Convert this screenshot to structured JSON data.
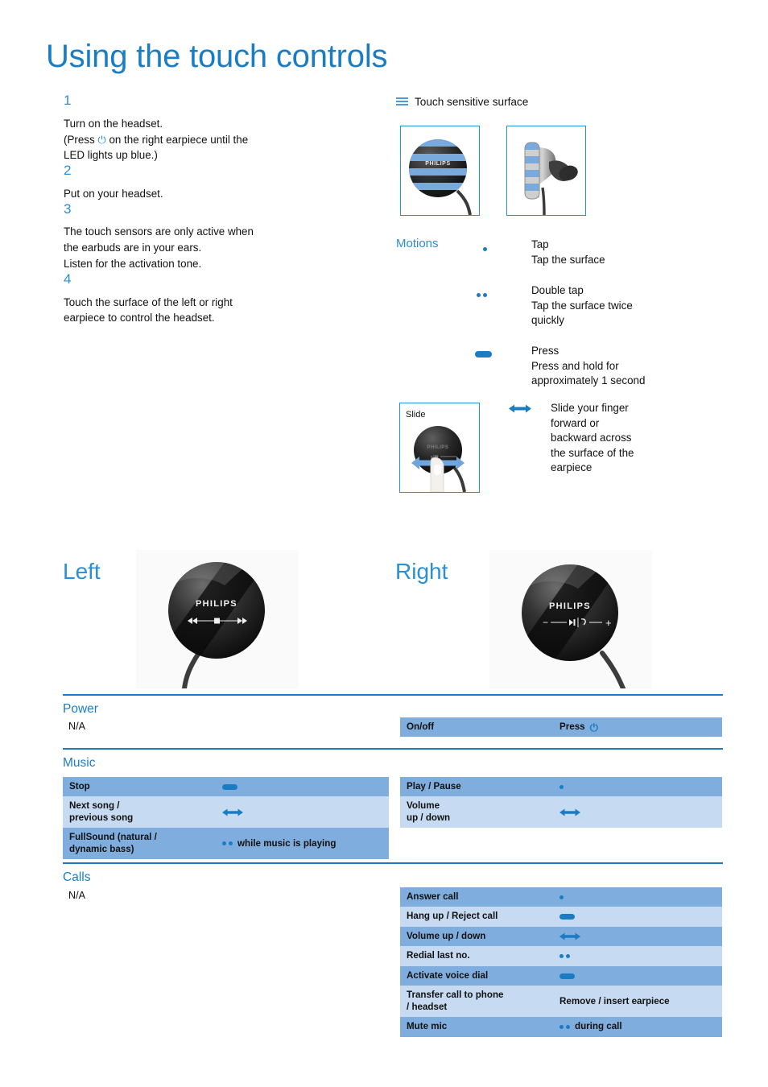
{
  "title": "Using the touch controls",
  "steps": [
    {
      "num": "1",
      "text": "Turn on the headset.\n(Press ⏻ on the right earpiece until the\nLED lights up blue.)"
    },
    {
      "num": "2",
      "text": "Put on your headset."
    },
    {
      "num": "3",
      "text": "The touch sensors are only active when\nthe earbuds are in your ears.\nListen for the activation tone."
    },
    {
      "num": "4",
      "text": "Touch the surface of the left or right\nearpiece to control the headset."
    }
  ],
  "touch_surface": {
    "heading": "Touch sensitive surface",
    "icon": "hamburger-lines-icon",
    "images": [
      {
        "name": "earpiece-front-striped",
        "brand": "PHILIPS"
      },
      {
        "name": "earpiece-side-striped"
      }
    ]
  },
  "motions": {
    "label": "Motions",
    "items": [
      {
        "icon": "single-dot-icon",
        "title": "Tap",
        "desc": "Tap the surface"
      },
      {
        "icon": "double-dot-icon",
        "title": "Double tap",
        "desc": "Tap the surface twice\nquickly"
      },
      {
        "icon": "press-bar-icon",
        "title": "Press",
        "desc": "Press and hold for\napproximately 1 second"
      },
      {
        "icon": "double-arrow-icon",
        "title": "",
        "desc": "Slide your finger\nforward or\nbackward across\nthe surface of the\nearpiece"
      }
    ],
    "slide_box_label": "Slide"
  },
  "earpieces": {
    "left": {
      "title": "Left",
      "brand": "PHILIPS",
      "controls": [
        "rewind",
        "stop",
        "fast-forward"
      ]
    },
    "right": {
      "title": "Right",
      "brand": "PHILIPS",
      "controls": [
        "volume-down",
        "play-pause",
        "call",
        "volume-up"
      ]
    }
  },
  "tables": {
    "power": {
      "title": "Power",
      "left_value": "N/A",
      "rows": [
        {
          "label": "On/off",
          "action_text": "Press",
          "action_icon": "power-symbol-icon"
        }
      ]
    },
    "music": {
      "title": "Music",
      "left_rows": [
        {
          "label": "Stop",
          "action_text": "",
          "action_icon": "press-bar-icon"
        },
        {
          "label": "Next song /\nprevious song",
          "action_text": "",
          "action_icon": "double-arrow-icon"
        },
        {
          "label": "FullSound (natural /\ndynamic bass)",
          "action_text": "while music is playing",
          "action_icon": "double-dot-icon"
        }
      ],
      "right_rows": [
        {
          "label": "Play / Pause",
          "action_text": "",
          "action_icon": "single-dot-icon"
        },
        {
          "label": "Volume\nup / down",
          "action_text": "",
          "action_icon": "double-arrow-icon"
        }
      ]
    },
    "calls": {
      "title": "Calls",
      "left_value": "N/A",
      "rows": [
        {
          "label": "Answer call",
          "action_text": "",
          "action_icon": "single-dot-icon"
        },
        {
          "label": "Hang up / Reject call",
          "action_text": "",
          "action_icon": "press-bar-icon"
        },
        {
          "label": "Volume up / down",
          "action_text": "",
          "action_icon": "double-arrow-icon"
        },
        {
          "label": "Redial last no.",
          "action_text": "",
          "action_icon": "double-dot-icon"
        },
        {
          "label": "Activate voice dial",
          "action_text": "",
          "action_icon": "press-bar-icon"
        },
        {
          "label": "Transfer call to phone\n/ headset",
          "action_text": "Remove / insert earpiece",
          "action_icon": "none"
        },
        {
          "label": "Mute mic",
          "action_text": "during call",
          "action_icon": "double-dot-icon"
        }
      ]
    }
  },
  "colors": {
    "accent_blue": "#1a7dc4",
    "heading_blue": "#2a8fd4",
    "row_dark": "#7fadde",
    "row_light": "#c6daf2"
  }
}
